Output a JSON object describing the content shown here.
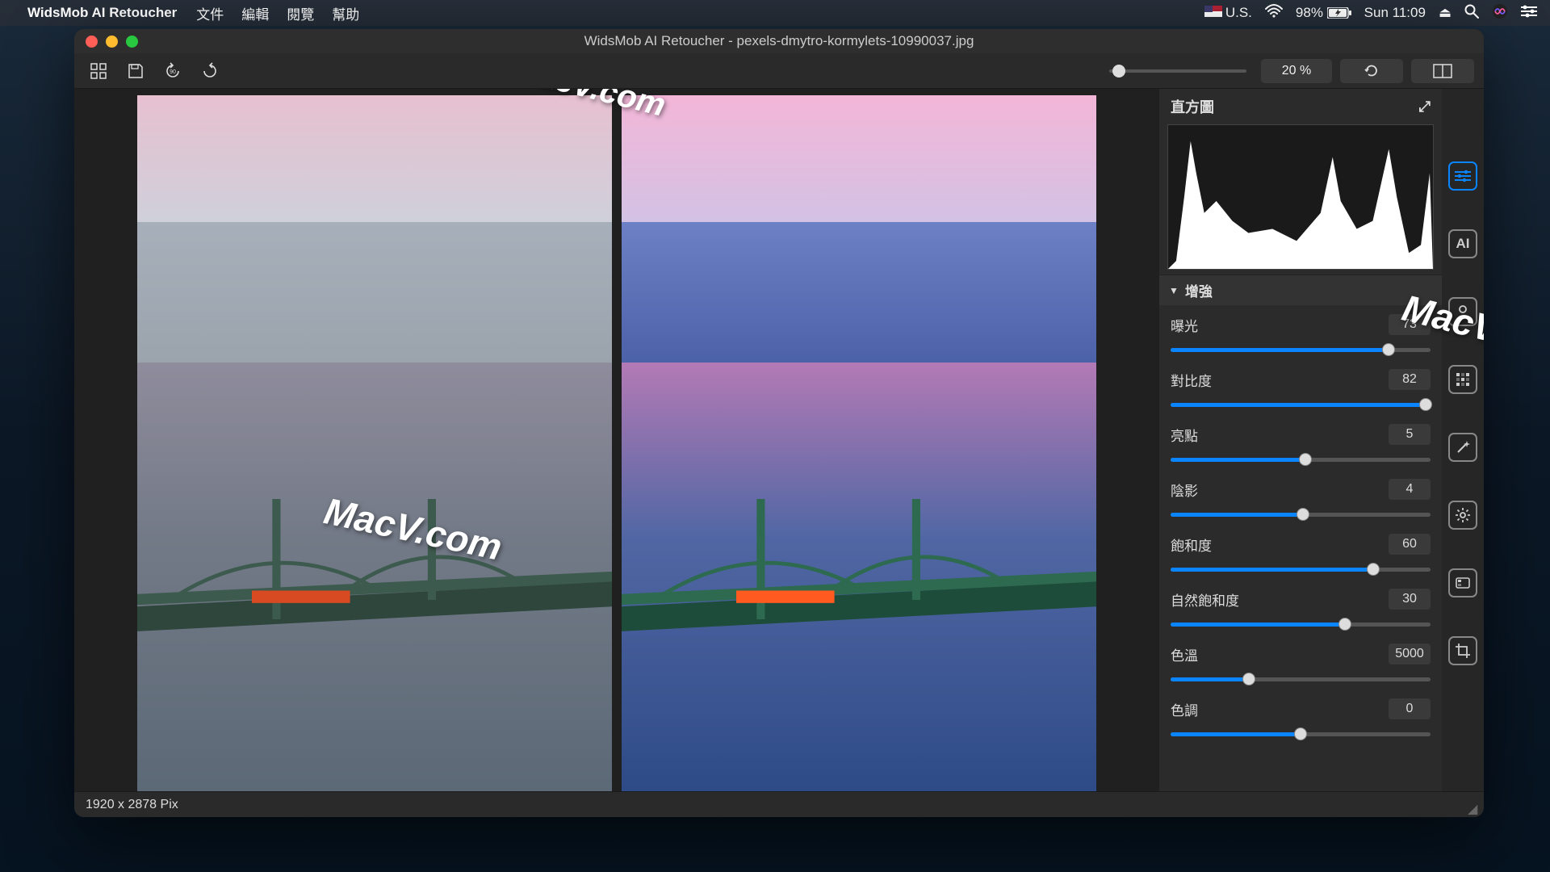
{
  "menubar": {
    "app_name": "WidsMob AI Retoucher",
    "items": [
      "文件",
      "編輯",
      "閱覽",
      "幫助"
    ],
    "right": {
      "input": "U.S.",
      "battery": "98%",
      "clock": "Sun 11:09"
    }
  },
  "window": {
    "title": "WidsMob AI Retoucher - pexels-dmytro-kormylets-10990037.jpg",
    "zoom_label": "20 %",
    "status": "1920 x 2878 Pix"
  },
  "watermark": "MacV.com",
  "panel": {
    "histogram_title": "直方圖",
    "section_title": "增強",
    "controls": [
      {
        "label": "曝光",
        "value": "73",
        "min": 0,
        "max": 100,
        "percent": 84
      },
      {
        "label": "對比度",
        "value": "82",
        "min": 0,
        "max": 100,
        "percent": 98
      },
      {
        "label": "亮點",
        "value": "5",
        "min": 0,
        "max": 100,
        "percent": 52
      },
      {
        "label": "陰影",
        "value": "4",
        "min": 0,
        "max": 100,
        "percent": 51
      },
      {
        "label": "飽和度",
        "value": "60",
        "min": 0,
        "max": 100,
        "percent": 78
      },
      {
        "label": "自然飽和度",
        "value": "30",
        "min": 0,
        "max": 100,
        "percent": 67
      },
      {
        "label": "色溫",
        "value": "5000",
        "min": 2000,
        "max": 10000,
        "percent": 30
      },
      {
        "label": "色調",
        "value": "0",
        "min": -100,
        "max": 100,
        "percent": 50
      }
    ]
  },
  "tooltabs": [
    {
      "name": "adjustments",
      "active": true
    },
    {
      "name": "ai",
      "active": false
    },
    {
      "name": "portrait",
      "active": false
    },
    {
      "name": "noise",
      "active": false
    },
    {
      "name": "wand",
      "active": false
    },
    {
      "name": "settings",
      "active": false
    },
    {
      "name": "palette",
      "active": false
    },
    {
      "name": "crop",
      "active": false
    }
  ]
}
